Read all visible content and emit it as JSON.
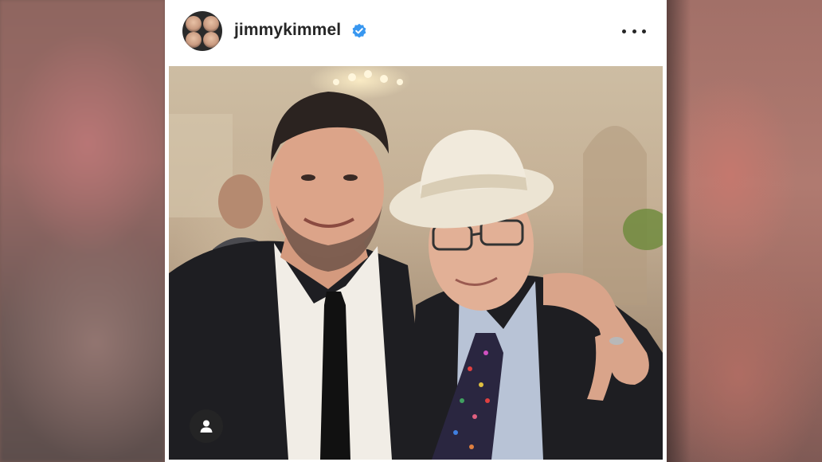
{
  "post": {
    "username": "jimmykimmel",
    "verified": true,
    "more_icon": "more-options-icon",
    "tag_icon": "user-tag-icon"
  },
  "colors": {
    "verified_blue": "#3897f0",
    "username_text": "#262626",
    "card_bg": "#ffffff"
  }
}
